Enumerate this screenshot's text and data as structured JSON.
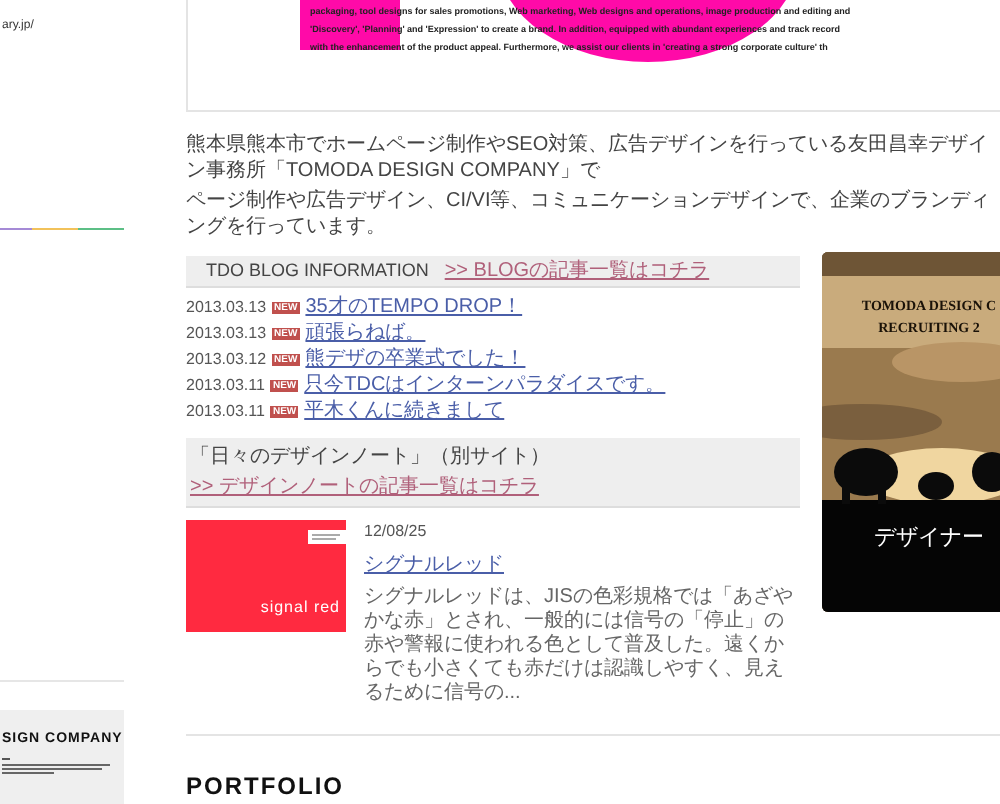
{
  "left": {
    "url": "ary.jp/",
    "company": "SIGN COMPANY"
  },
  "intro_box": {
    "lines": [
      "packaging, tool designs for sales promotions, Web marketing, Web designs and operations, image production and editing and",
      "'Discovery', 'Planning' and 'Expression' to create a brand. In addition, equipped with abundant experiences and track record",
      "with the enhancement of the product appeal. Furthermore, we assist our clients in 'creating a strong corporate culture' th"
    ]
  },
  "description": [
    "熊本県熊本市でホームページ制作やSEO対策、広告デザインを行っている友田昌幸デザイン事務所「TOMODA DESIGN COMPANY」で",
    "ページ制作や広告デザイン、CI/VI等、コミュニケーションデザインで、企業のブランディングを行っています。"
  ],
  "blog": {
    "title": "TDO BLOG INFORMATION",
    "more_link": ">> BLOGの記事一覧はコチラ",
    "posts": [
      {
        "date": "2013.03.13",
        "badge": "NEW",
        "title": "35才のTEMPO DROP！"
      },
      {
        "date": "2013.03.13",
        "badge": "NEW",
        "title": "頑張らねば。"
      },
      {
        "date": "2013.03.12",
        "badge": "NEW",
        "title": "熊デザの卒業式でした！"
      },
      {
        "date": "2013.03.11",
        "badge": "NEW",
        "title": "只今TDCはインターンパラダイスです。"
      },
      {
        "date": "2013.03.11",
        "badge": "NEW",
        "title": "平木くんに続きまして"
      }
    ]
  },
  "design_note": {
    "title": "「日々のデザインノート」（別サイト）",
    "more_link": ">> デザインノートの記事一覧はコチラ",
    "entry": {
      "thumbnail_caption": "signal red",
      "date": "12/08/25",
      "title": "シグナルレッド",
      "excerpt": "シグナルレッドは、JISの色彩規格では「あざやかな赤」とされ、一般的には信号の「停止」の赤や警報に使われる色として普及した。遠くからでも小さくても赤だけは認識しやすく、見えるために信号の..."
    }
  },
  "banner": {
    "title": "TOMODA DESIGN C",
    "subtitle": "RECRUITING 2",
    "caption": "デザイナー"
  },
  "portfolio": {
    "heading": "PORTFOLIO"
  }
}
